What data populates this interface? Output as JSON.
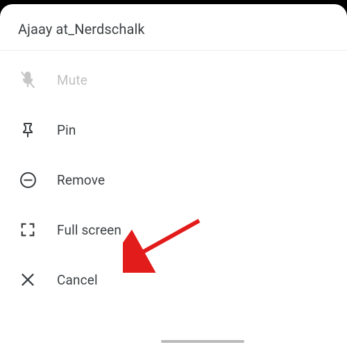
{
  "header": {
    "title": "Ajaay at_Nerdschalk"
  },
  "menu": {
    "mute": {
      "label": "Mute"
    },
    "pin": {
      "label": "Pin"
    },
    "remove": {
      "label": "Remove"
    },
    "fullscreen": {
      "label": "Full screen"
    },
    "cancel": {
      "label": "Cancel"
    }
  }
}
